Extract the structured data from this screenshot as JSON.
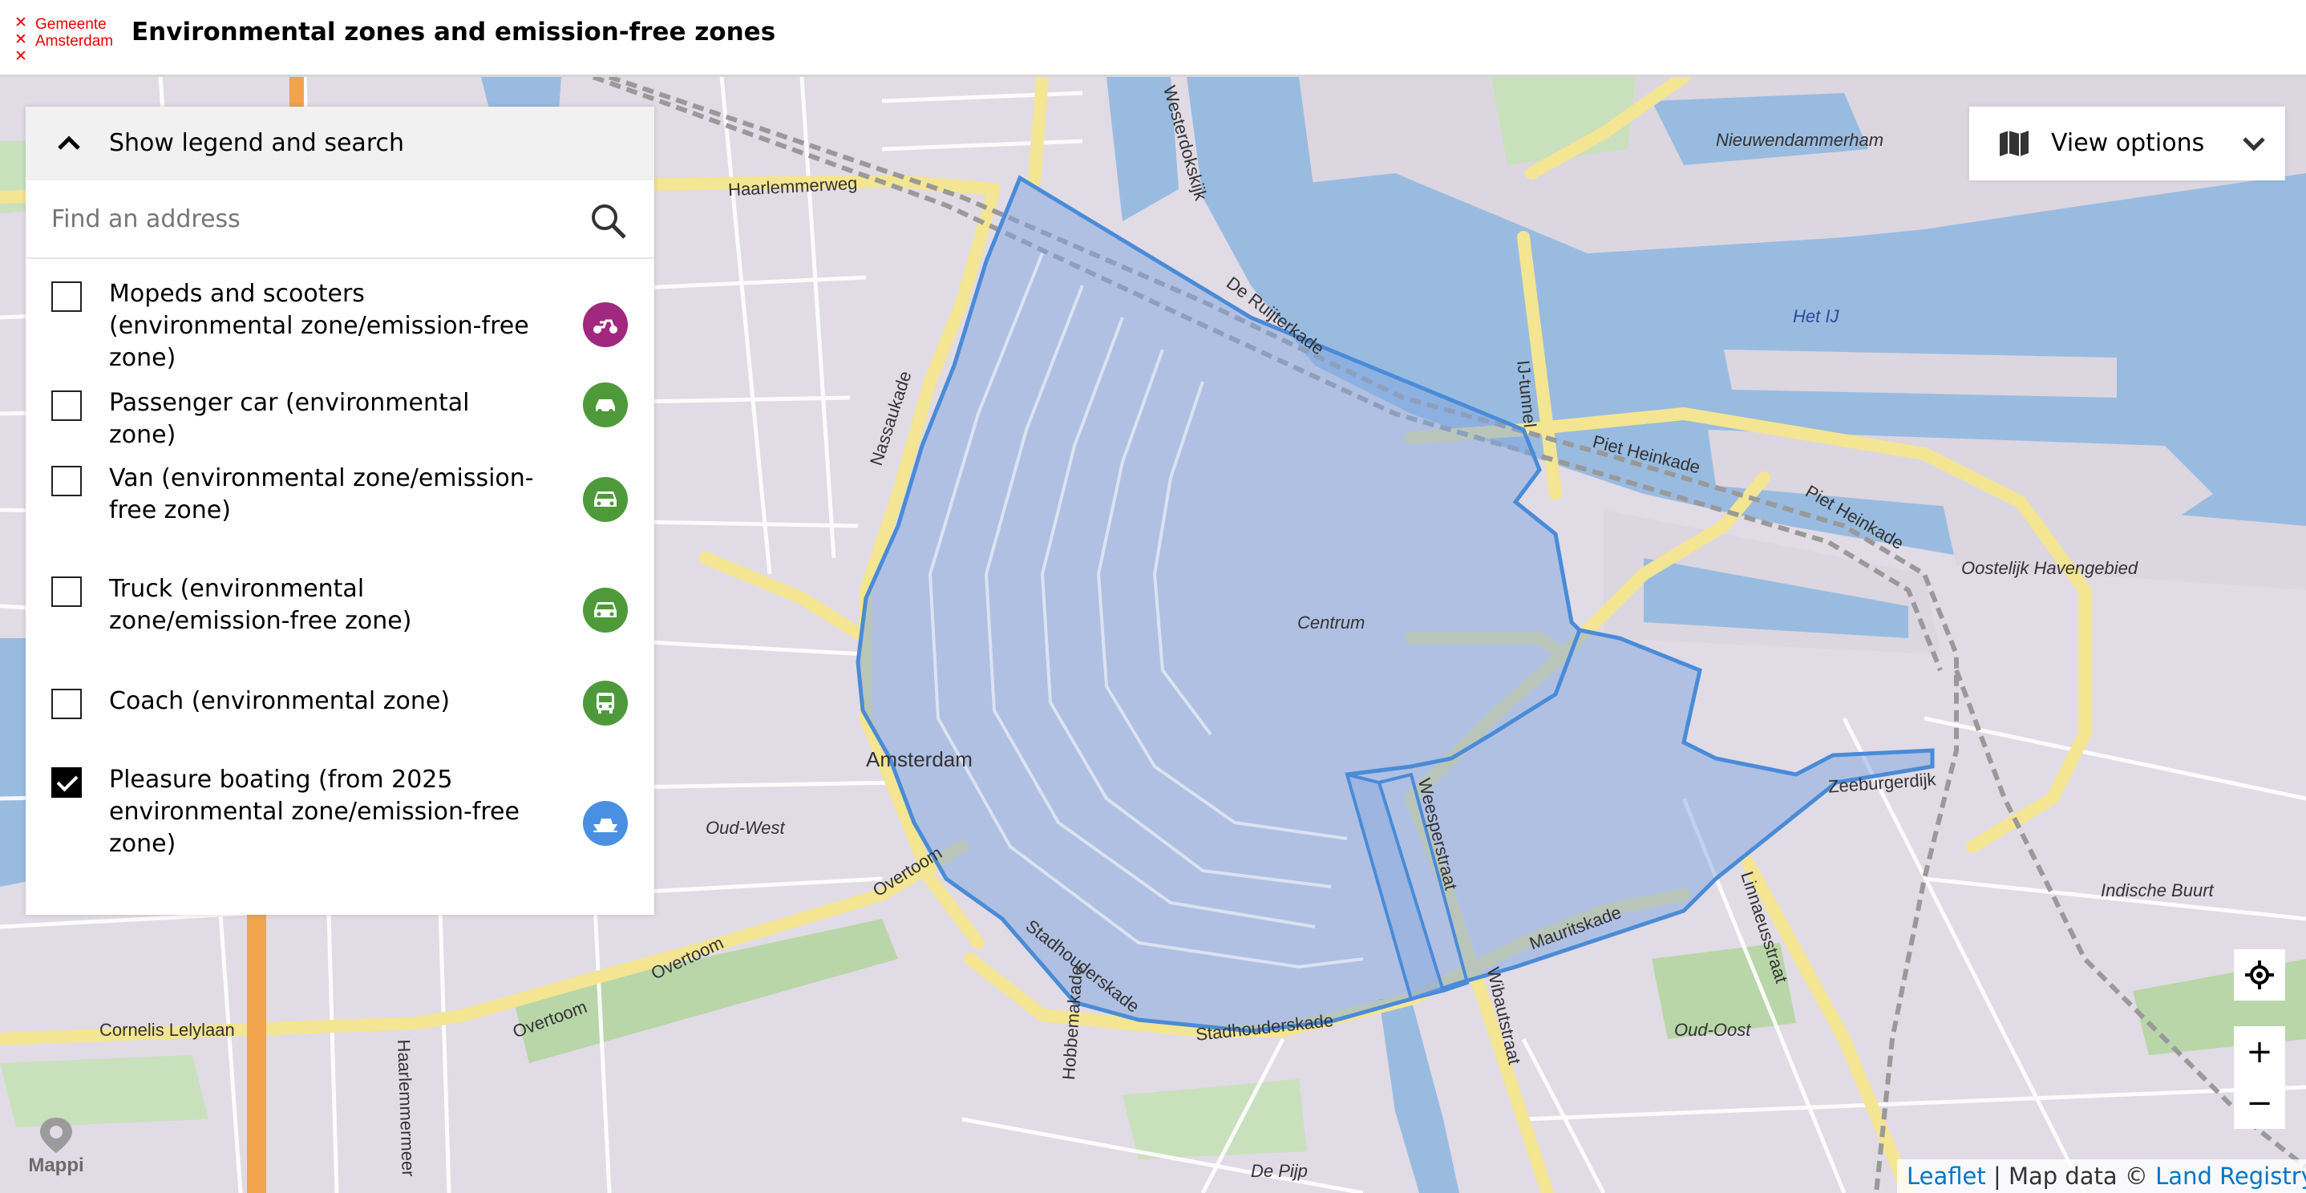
{
  "header": {
    "logo_line1": "Gemeente",
    "logo_line2": "Amsterdam",
    "title": "Environmental zones and emission-free zones"
  },
  "legend_panel": {
    "toggle_label": "Show legend and search",
    "search_placeholder": "Find an address",
    "items": [
      {
        "label": "Mopeds and scooters (environmental zone/emission-free zone)",
        "checked": false,
        "icon": "scooter-icon",
        "color": "#a0287e"
      },
      {
        "label": "Passenger car (environmental zone)",
        "checked": false,
        "icon": "car-icon",
        "color": "#4e9a3b"
      },
      {
        "label": "Van (environmental zone/emission-free zone)",
        "checked": false,
        "icon": "van-icon",
        "color": "#4e9a3b"
      },
      {
        "label": "Truck (environmental zone/emission-free zone)",
        "checked": false,
        "icon": "truck-icon",
        "color": "#4e9a3b"
      },
      {
        "label": "Coach (environmental zone)",
        "checked": false,
        "icon": "coach-icon",
        "color": "#4e9a3b"
      },
      {
        "label": "Pleasure boating (from 2025 environmental zone/emission-free zone)",
        "checked": true,
        "icon": "boat-icon",
        "color": "#4a90e2"
      }
    ]
  },
  "view_options": {
    "label": "View options"
  },
  "map_controls": {
    "zoom_in": "+",
    "zoom_out": "−"
  },
  "branding": {
    "mappi": "Mappi"
  },
  "attribution": {
    "leaflet": "Leaflet",
    "separator": " | Map data © ",
    "provider": "Land Registry"
  },
  "map_labels": [
    {
      "text": "Haarlemmerweg",
      "kind": "street"
    },
    {
      "text": "Nassaukade",
      "kind": "street"
    },
    {
      "text": "De Ruijterkade",
      "kind": "street"
    },
    {
      "text": "IJ-tunnel",
      "kind": "street"
    },
    {
      "text": "Piet Heinkade",
      "kind": "street"
    },
    {
      "text": "Piet Heinkade",
      "kind": "street"
    },
    {
      "text": "Nieuwendammerham",
      "kind": "district"
    },
    {
      "text": "Het IJ",
      "kind": "water"
    },
    {
      "text": "Oostelijk Havengebied",
      "kind": "district"
    },
    {
      "text": "Centrum",
      "kind": "district"
    },
    {
      "text": "Amsterdam",
      "kind": "city"
    },
    {
      "text": "Oud-West",
      "kind": "district"
    },
    {
      "text": "Zeeburgerdijk",
      "kind": "street"
    },
    {
      "text": "Indische Buurt",
      "kind": "district"
    },
    {
      "text": "Weesperstraat",
      "kind": "street"
    },
    {
      "text": "Mauritskade",
      "kind": "street"
    },
    {
      "text": "Linnaeusstraat",
      "kind": "street"
    },
    {
      "text": "Overtoom",
      "kind": "street"
    },
    {
      "text": "Overtoom",
      "kind": "street"
    },
    {
      "text": "Overtoom",
      "kind": "street"
    },
    {
      "text": "Cornelis Lelylaan",
      "kind": "street"
    },
    {
      "text": "Stadhouderskade",
      "kind": "street"
    },
    {
      "text": "Stadhouderskade",
      "kind": "street"
    },
    {
      "text": "Wibautstraat",
      "kind": "street"
    },
    {
      "text": "Oud-Oost",
      "kind": "district"
    },
    {
      "text": "De Pijp",
      "kind": "district"
    },
    {
      "text": "Hobbemakade",
      "kind": "street"
    },
    {
      "text": "Haarlemmermeer",
      "kind": "street"
    },
    {
      "text": "Westerdokskijk",
      "kind": "street"
    }
  ]
}
